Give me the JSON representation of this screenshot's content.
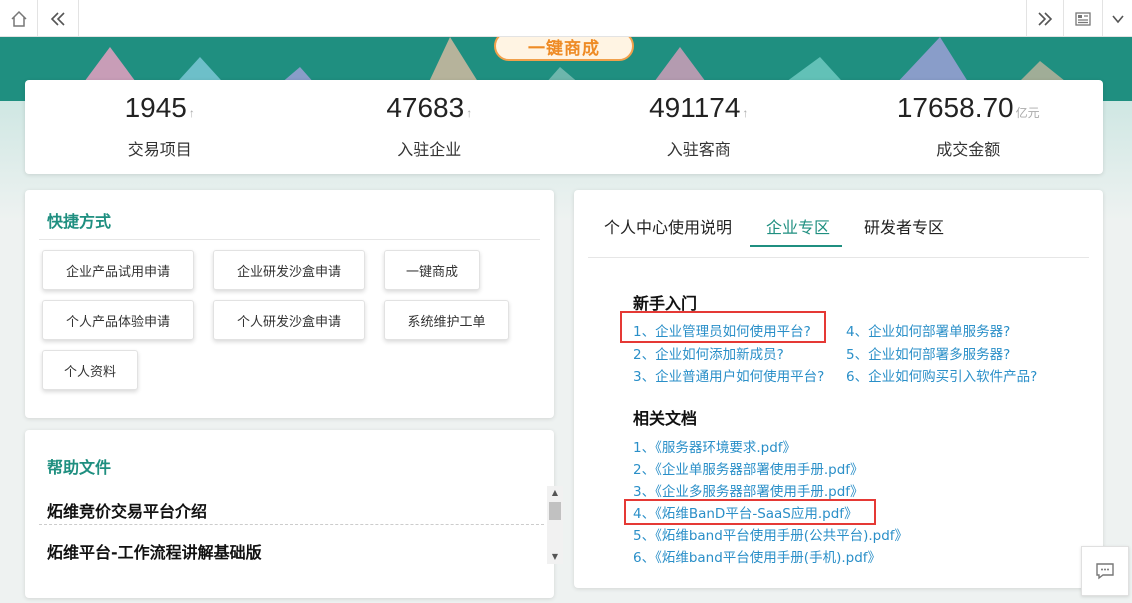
{
  "banner": {
    "button_label": "一键商成"
  },
  "stats": [
    {
      "value": "1945",
      "suffix": "↑",
      "label": "交易项目"
    },
    {
      "value": "47683",
      "suffix": "↑",
      "label": "入驻企业"
    },
    {
      "value": "491174",
      "suffix": "↑",
      "label": "入驻客商"
    },
    {
      "value": "17658.70",
      "suffix": "亿元",
      "label": "成交金额"
    }
  ],
  "shortcuts": {
    "title": "快捷方式",
    "buttons": [
      "企业产品试用申请",
      "企业研发沙盒申请",
      "一键商成",
      "个人产品体验申请",
      "个人研发沙盒申请",
      "系统维护工单",
      "个人资料"
    ]
  },
  "help": {
    "title": "帮助文件",
    "items": [
      "炻维竞价交易平台介绍",
      "炻维平台-工作流程讲解基础版"
    ]
  },
  "docs": {
    "tabs": [
      "个人中心使用说明",
      "企业专区",
      "研发者专区"
    ],
    "active_tab": "企业专区",
    "getting_started": {
      "title": "新手入门",
      "left": [
        "1、企业管理员如何使用平台?",
        "2、企业如何添加新成员?",
        "3、企业普通用户如何使用平台?"
      ],
      "right": [
        "4、企业如何部署单服务器?",
        "5、企业如何部署多服务器?",
        "6、企业如何购买引入软件产品?"
      ]
    },
    "related": {
      "title": "相关文档",
      "items": [
        "1、《服务器环境要求.pdf》",
        "2、《企业单服务器部署使用手册.pdf》",
        "3、《企业多服务器部署使用手册.pdf》",
        "4、《炻维BanD平台-SaaS应用.pdf》",
        "5、《炻维band平台使用手册(公共平台).pdf》",
        "6、《炻维band平台使用手册(手机).pdf》"
      ]
    }
  },
  "colors": {
    "accent": "#1f8f80",
    "link": "#2a8fc8",
    "highlight": "#e53935",
    "banner_button": "#ee8b25"
  }
}
